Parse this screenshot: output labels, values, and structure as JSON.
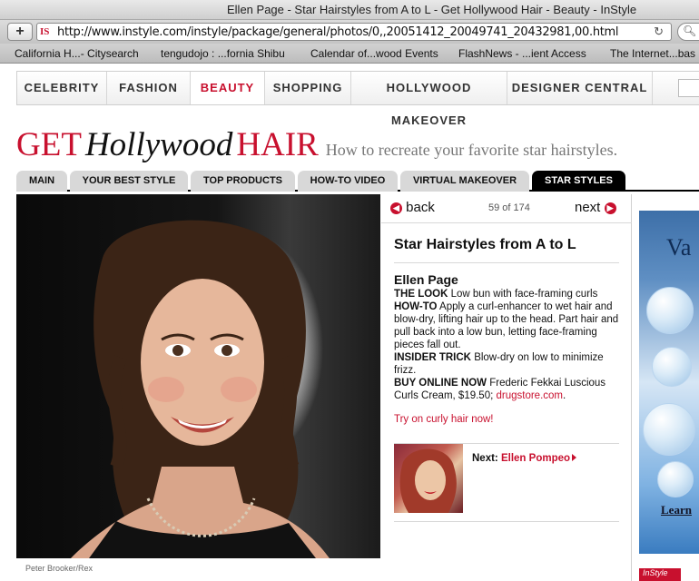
{
  "browser": {
    "title": "Ellen Page - Star Hairstyles from A to L - Get Hollywood Hair - Beauty - InStyle",
    "url": "http://www.instyle.com/instyle/package/general/photos/0,,20051412_20049741_20432981,00.html",
    "favicon": "IS",
    "add_label": "+",
    "bookmarks": [
      "California H...- Citysearch",
      "tengudojo : ...fornia Shibu",
      "Calendar of...wood Events",
      "FlashNews - ...ient Access",
      "The Internet...bas"
    ]
  },
  "nav": {
    "items": [
      "CELEBRITY",
      "FASHION",
      "BEAUTY",
      "SHOPPING",
      "HOLLYWOOD MAKEOVER",
      "DESIGNER CENTRAL"
    ],
    "active": "BEAUTY"
  },
  "header": {
    "get": "GET",
    "hollywood": "Hollywood",
    "hair": "HAIR",
    "subtitle": "How to recreate your favorite star hairstyles."
  },
  "tabs": {
    "items": [
      "MAIN",
      "YOUR BEST STYLE",
      "TOP PRODUCTS",
      "HOW-TO VIDEO",
      "VIRTUAL MAKEOVER",
      "STAR STYLES"
    ],
    "active": "STAR STYLES"
  },
  "photo": {
    "credit": "Peter Brooker/Rex"
  },
  "gallery": {
    "back_label": "back",
    "next_label": "next",
    "counter": "59 of 174",
    "title": "Star Hairstyles from A to L",
    "celebrity": "Ellen Page",
    "look_label": "THE LOOK",
    "look_text": "Low bun with face-framing curls",
    "howto_label": "HOW-TO",
    "howto_text": "Apply a curl-enhancer to wet hair and blow-dry, lifting hair up to the head. Part hair and pull back into a low bun, letting face-framing pieces fall out.",
    "trick_label": "INSIDER TRICK",
    "trick_text": "Blow-dry on low to minimize frizz.",
    "buy_label": "BUY ONLINE NOW",
    "buy_text": "Frederic Fekkai Luscious Curls Cream, $19.50;",
    "buy_link": "drugstore.com",
    "buy_end": ".",
    "try_link": "Try on curly hair now!",
    "next_prefix": "Next:",
    "next_name": "Ellen Pompeo"
  },
  "ad": {
    "heading": "Va",
    "learn": "Learn",
    "footer_logo": "InStyle"
  },
  "colors": {
    "accent": "#c8102e",
    "active_tab": "#000000"
  }
}
